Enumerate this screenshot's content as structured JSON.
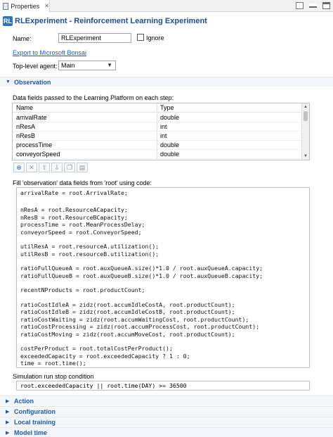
{
  "tab": {
    "label": "Properties",
    "close": "✕"
  },
  "header": {
    "icon_text": "RL",
    "title": "RLExperiment - Reinforcement Learning Experiment"
  },
  "form": {
    "name_label": "Name:",
    "name_value": "RLExperiment",
    "ignore_label": "Ignore",
    "export_link": "Export to Microsoft Bonsai",
    "top_agent_label": "Top-level agent:",
    "top_agent_value": "Main"
  },
  "observation": {
    "section_label": "Observation",
    "fields_caption": "Data fields passed to the Learning Platform on each step:",
    "table": {
      "headers": {
        "name": "Name",
        "type": "Type"
      },
      "rows": [
        {
          "name": "arrivalRate",
          "type": "double"
        },
        {
          "name": "nResA",
          "type": "int"
        },
        {
          "name": "nResB",
          "type": "int"
        },
        {
          "name": "processTime",
          "type": "double"
        },
        {
          "name": "conveyorSpeed",
          "type": "double"
        }
      ]
    },
    "fill_caption": "Fill 'observation' data fields from 'root' using code:",
    "code_lines": [
      "arrivalRate = root.ArrivalRate;",
      "",
      "nResA = root.ResourceACapacity;",
      "nResB = root.ResourceBCapacity;",
      "processTime = root.MeanProcessDelay;",
      "conveyorSpeed = root.ConveyorSpeed;",
      "",
      "utilResA = root.resourceA.utilization();",
      "utilResB = root.resourceB.utilization();",
      "",
      "ratioFullQueueA = root.auxQueueA.size()*1.0 / root.auxQueueA.capacity;",
      "ratioFullQueueB = root.auxQueueB.size()*1.0 / root.auxQueueB.capacity;",
      "",
      "recentNProducts = root.productCount;",
      "",
      "ratioCostIdleA = zidz(root.accumIdleCostA, root.productCount);",
      "ratioCostIdleB = zidz(root.accumIdleCostB, root.productCount);",
      "ratioCostWaiting = zidz(root.accumWaitingCost, root.productCount);",
      "ratioCostProcessing = zidz(root.accumProcessCost, root.productCount);",
      "ratioCostMoving = zidz(root.accumMoveCost, root.productCount);",
      "",
      "costPerProduct = root.totalCostPerProduct();",
      "exceededCapacity = root.exceededCapacity ? 1 : 0;",
      "time = root.time();"
    ],
    "stop_caption": "Simulation run stop condition",
    "stop_condition": "root.exceededCapacity || root.time(DAY) >= 36500"
  },
  "sections": [
    {
      "label": "Action"
    },
    {
      "label": "Configuration"
    },
    {
      "label": "Local training"
    },
    {
      "label": "Model time"
    }
  ],
  "colors": {
    "accent": "#1f5ba7",
    "title": "#1f4e8c",
    "link": "#1a5fb4"
  }
}
